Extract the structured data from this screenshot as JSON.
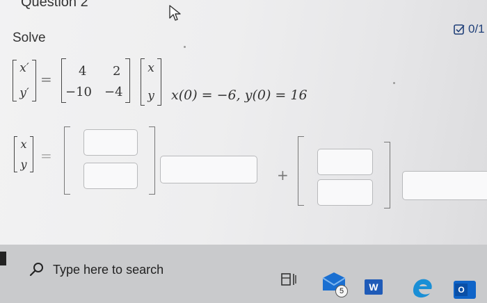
{
  "header": {
    "question_title": "Question 2",
    "score": "0/1"
  },
  "problem": {
    "instruction": "Solve",
    "lhs_vector": [
      "x′",
      "y′"
    ],
    "matrix": [
      [
        "4",
        "2"
      ],
      [
        "−10",
        "−4"
      ]
    ],
    "rhs_vector": [
      "x",
      "y"
    ],
    "initial_conditions": "x(0) = −6, y(0) = 16",
    "equals": "="
  },
  "answer": {
    "lhs_vector": [
      "x",
      "y"
    ],
    "equals": "=",
    "plus": "+"
  },
  "taskbar": {
    "search_placeholder": "Type here to search",
    "mail_badge": "5",
    "word_letter": "W",
    "outlook_letter": "O"
  }
}
